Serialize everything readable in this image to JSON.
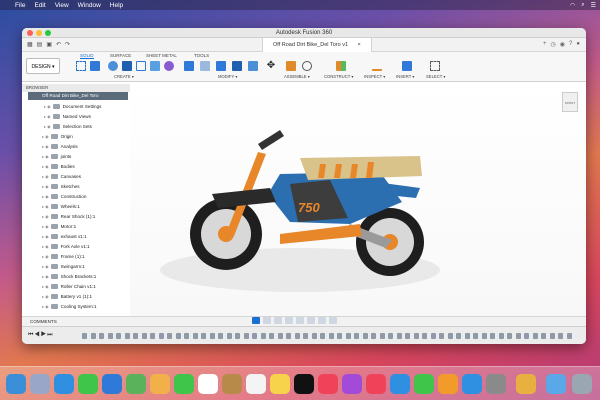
{
  "menubar": {
    "items": [
      "File",
      "Edit",
      "View",
      "Window",
      "Help"
    ]
  },
  "window": {
    "title": "Autodesk Fusion 360",
    "document_tab": "Off Road Dirt Bike_Del Toro v1"
  },
  "toolbar": {
    "design_button": "DESIGN ▾",
    "workspace_tabs": [
      "SOLID",
      "SURFACE",
      "SHEET METAL",
      "TOOLS"
    ],
    "groups": [
      "CREATE ▾",
      "MODIFY ▾",
      "ASSEMBLE ▾",
      "CONSTRUCT ▾",
      "INSPECT ▾",
      "INSERT ▾",
      "SELECT ▾"
    ]
  },
  "browser": {
    "header": "BROWSER",
    "root": "Off Road Dirt Bike_Del Toro",
    "items": [
      "Document Settings",
      "Named Views",
      "Selection Sets",
      "Origin",
      "Analysis",
      "joints",
      "Bodies",
      "Canvases",
      "Sketches",
      "Construction",
      "Wheels:1",
      "Rear Shock (1):1",
      "Motor:1",
      "exhaust v1:1",
      "Fork Axle v1:1",
      "Frame (1):1",
      "Swingarm:1",
      "Shock Brackets:1",
      "Roller Chain v1:1",
      "Battery v1 (1):1",
      "Cooling System:1"
    ]
  },
  "viewcube": {
    "label": "FRONT"
  },
  "model": {
    "number_plate": "750"
  },
  "comments": {
    "label": "COMMENTS"
  },
  "colors": {
    "accent": "#1a6fd0",
    "root_row": "#5c6b7a",
    "bike_orange": "#e8862a",
    "bike_blue": "#2b6fb0"
  }
}
